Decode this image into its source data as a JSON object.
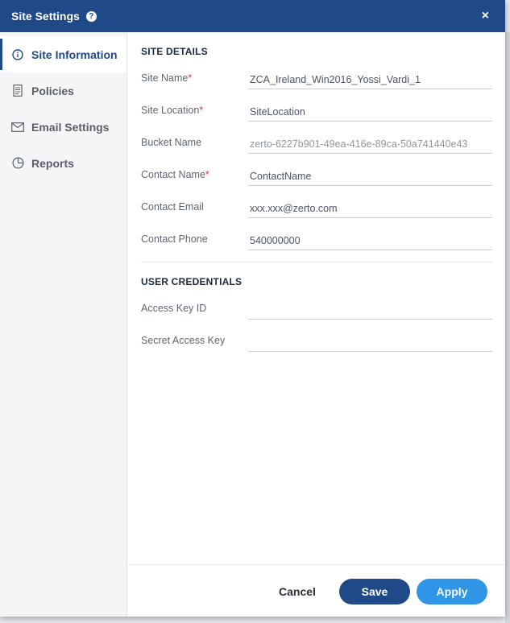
{
  "dialog": {
    "title": "Site Settings",
    "help_glyph": "?",
    "close_glyph": "×"
  },
  "sidebar": {
    "items": [
      {
        "label": "Site Information",
        "icon": "info-icon",
        "active": true
      },
      {
        "label": "Policies",
        "icon": "document-icon",
        "active": false
      },
      {
        "label": "Email Settings",
        "icon": "envelope-icon",
        "active": false
      },
      {
        "label": "Reports",
        "icon": "pie-chart-icon",
        "active": false
      }
    ]
  },
  "site_details": {
    "heading": "SITE DETAILS",
    "fields": [
      {
        "label": "Site Name",
        "required": true,
        "value": "ZCA_Ireland_Win2016_Yossi_Vardi_1"
      },
      {
        "label": "Site Location",
        "required": true,
        "value": "SiteLocation"
      },
      {
        "label": "Bucket Name",
        "required": false,
        "value": "zerto-6227b901-49ea-416e-89ca-50a741440e43",
        "readonly": true
      },
      {
        "label": "Contact Name",
        "required": true,
        "value": "ContactName"
      },
      {
        "label": "Contact Email",
        "required": false,
        "value": "xxx.xxx@zerto.com"
      },
      {
        "label": "Contact Phone",
        "required": false,
        "value": "540000000"
      }
    ]
  },
  "user_credentials": {
    "heading": "USER CREDENTIALS",
    "fields": [
      {
        "label": "Access Key ID",
        "value": ""
      },
      {
        "label": "Secret Access Key",
        "value": ""
      }
    ]
  },
  "footer": {
    "cancel_label": "Cancel",
    "save_label": "Save",
    "apply_label": "Apply"
  },
  "colors": {
    "header": "#1f4a87",
    "save_button": "#1f4a87",
    "apply_button": "#2f95e6",
    "required_marker": "#e0353b"
  }
}
